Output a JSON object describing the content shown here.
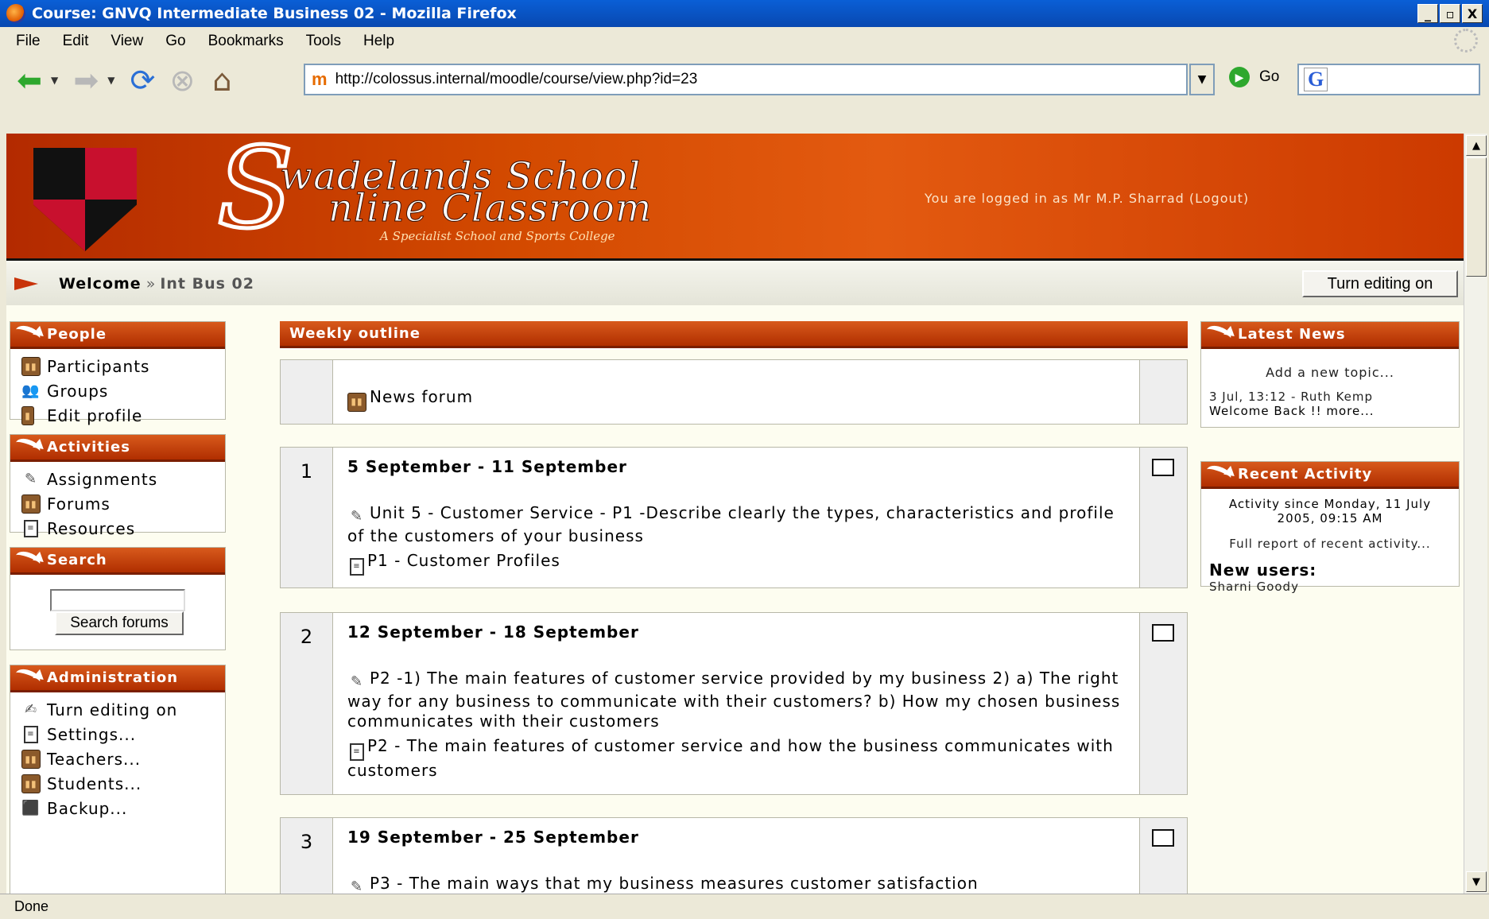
{
  "window": {
    "title": "Course: GNVQ Intermediate Business 02 - Mozilla Firefox",
    "buttons": [
      "_",
      "▫",
      "X"
    ]
  },
  "menu": [
    "File",
    "Edit",
    "View",
    "Go",
    "Bookmarks",
    "Tools",
    "Help"
  ],
  "nav": {
    "url": "http://colossus.internal/moodle/course/view.php?id=23",
    "go_label": "Go",
    "search_logo": "G"
  },
  "header": {
    "school_line1": "wadelands School",
    "school_line2": "nline Classroom",
    "tagline": "A Specialist School and Sports College",
    "login_text": "You are logged in as Mr M.P. Sharrad (Logout)"
  },
  "breadcrumb": {
    "home": "Welcome",
    "separator": "»",
    "current": "Int Bus 02"
  },
  "edit_button": "Turn editing on",
  "left": {
    "people": {
      "title": "People",
      "items": [
        {
          "label": "Participants",
          "icon": "participants-icon"
        },
        {
          "label": "Groups",
          "icon": "groups-icon"
        },
        {
          "label": "Edit profile",
          "icon": "profile-icon"
        }
      ]
    },
    "activities": {
      "title": "Activities",
      "items": [
        {
          "label": "Assignments",
          "icon": "assignment-icon"
        },
        {
          "label": "Forums",
          "icon": "forum-icon"
        },
        {
          "label": "Resources",
          "icon": "resource-icon"
        }
      ]
    },
    "search": {
      "title": "Search",
      "input_value": "",
      "button": "Search forums"
    },
    "admin": {
      "title": "Administration",
      "items": [
        {
          "label": "Turn editing on",
          "icon": "edit-icon"
        },
        {
          "label": "Settings...",
          "icon": "settings-icon"
        },
        {
          "label": "Teachers...",
          "icon": "teachers-icon"
        },
        {
          "label": "Students...",
          "icon": "students-icon"
        },
        {
          "label": "Backup...",
          "icon": "backup-icon"
        }
      ]
    }
  },
  "center": {
    "title": "Weekly outline",
    "news_forum": "News forum",
    "weeks": [
      {
        "num": "1",
        "title": "5 September - 11 September",
        "assignment": "Unit 5 - Customer Service - P1 -Describe clearly the types, characteristics and profile of the customers of your business",
        "resource": "P1 - Customer Profiles"
      },
      {
        "num": "2",
        "title": "12 September - 18 September",
        "assignment": "P2 -1) The main features of customer service provided by my business 2) a) The right way for any business to communicate with their customers? b) How my chosen business communicates with their customers",
        "resource": "P2 - The main features of customer service and how the business communicates with customers"
      },
      {
        "num": "3",
        "title": "19 September - 25 September",
        "assignment": "P3 - The main ways that my business measures customer satisfaction"
      }
    ]
  },
  "right": {
    "news": {
      "title": "Latest News",
      "add_topic": "Add a new topic...",
      "post_meta": "3 Jul, 13:12 - Ruth Kemp",
      "post_title": "Welcome Back !! more..."
    },
    "recent": {
      "title": "Recent Activity",
      "since": "Activity since Monday, 11 July 2005, 09:15 AM",
      "full_report": "Full report of recent activity...",
      "new_users_label": "New users:",
      "new_user": "Sharni Goody"
    }
  },
  "status": "Done"
}
